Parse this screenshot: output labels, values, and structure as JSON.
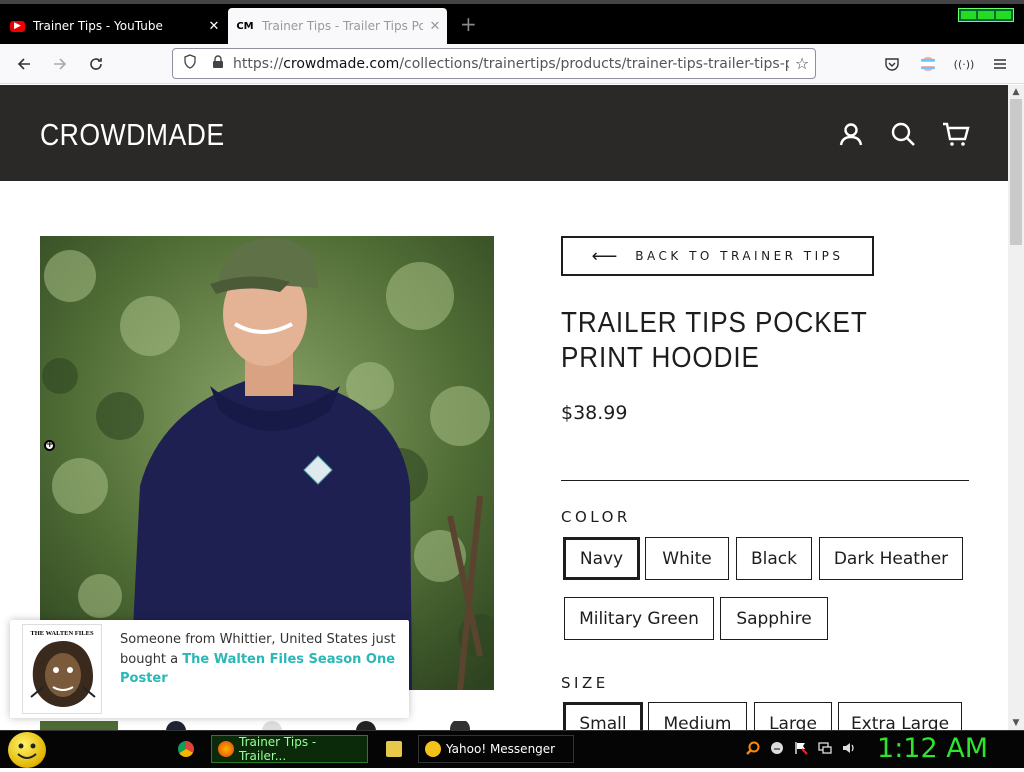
{
  "browser": {
    "tabs": [
      {
        "title": "Trainer Tips - YouTube",
        "favicon": "youtube-icon",
        "active": false
      },
      {
        "title": "Trainer Tips - Trailer Tips Pocke",
        "favicon": "CM",
        "active": true
      }
    ],
    "url_prefix": "https://",
    "url_host": "crowdmade.com",
    "url_path": "/collections/trainertips/products/trainer-tips-trailer-tips-pocket-prin"
  },
  "site": {
    "logo": "CROWDMADE",
    "header_bg": "#2b2927"
  },
  "product": {
    "back_label": "BACK TO TRAINER TIPS",
    "title": "TRAILER TIPS POCKET PRINT HOODIE",
    "price": "$38.99",
    "color_label": "COLOR",
    "colors": [
      "Navy",
      "White",
      "Black",
      "Dark Heather",
      "Military Green",
      "Sapphire"
    ],
    "selected_color": "Navy",
    "size_label": "SIZE",
    "sizes": [
      "Small",
      "Medium",
      "Large",
      "Extra Large"
    ],
    "selected_size": "Small"
  },
  "popup": {
    "message": "Someone from Whittier, United States just bought a ",
    "product_link": "The Walten Files Season One Poster",
    "thumb_title": "THE WALTEN FILES"
  },
  "taskbar": {
    "items": [
      "Trainer Tips - Trailer...",
      "Yahoo! Messenger"
    ],
    "clock": "1:12 AM"
  }
}
